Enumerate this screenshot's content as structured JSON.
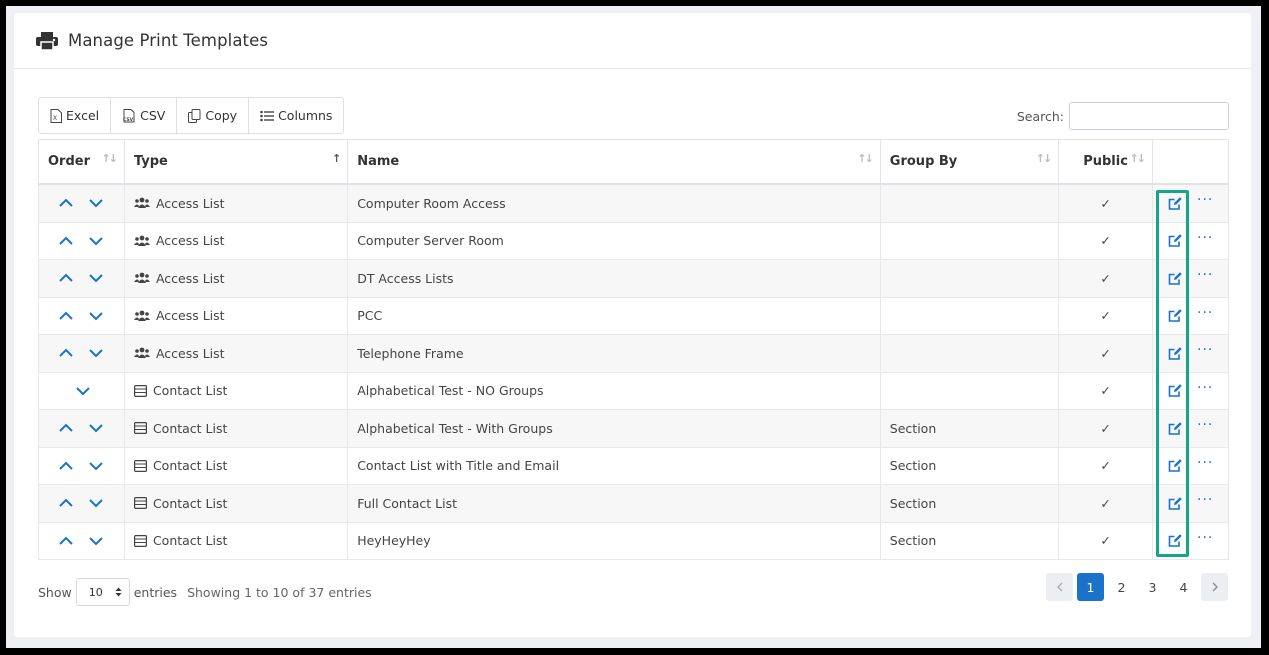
{
  "header": {
    "title": "Manage Print Templates",
    "icon": "printer-icon"
  },
  "toolbar": {
    "buttons": [
      {
        "label": "Excel",
        "icon": "excel-file-icon"
      },
      {
        "label": "CSV",
        "icon": "csv-file-icon"
      },
      {
        "label": "Copy",
        "icon": "copy-icon"
      },
      {
        "label": "Columns",
        "icon": "list-icon"
      }
    ]
  },
  "search": {
    "label": "Search:",
    "value": ""
  },
  "table": {
    "columns": [
      "Order",
      "Type",
      "Name",
      "Group By",
      "Public",
      ""
    ],
    "rows": [
      {
        "type": "Access List",
        "type_icon": "users-icon",
        "name": "Computer Room Access",
        "group_by": "",
        "public": "✓"
      },
      {
        "type": "Access List",
        "type_icon": "users-icon",
        "name": "Computer Server Room",
        "group_by": "",
        "public": "✓"
      },
      {
        "type": "Access List",
        "type_icon": "users-icon",
        "name": "DT Access Lists",
        "group_by": "",
        "public": "✓"
      },
      {
        "type": "Access List",
        "type_icon": "users-icon",
        "name": "PCC",
        "group_by": "",
        "public": "✓"
      },
      {
        "type": "Access List",
        "type_icon": "users-icon",
        "name": "Telephone Frame",
        "group_by": "",
        "public": "✓"
      },
      {
        "type": "Contact List",
        "type_icon": "table-icon",
        "name": "Alphabetical Test - NO Groups",
        "group_by": "",
        "public": "✓"
      },
      {
        "type": "Contact List",
        "type_icon": "table-icon",
        "name": "Alphabetical Test - With Groups",
        "group_by": "Section",
        "public": "✓"
      },
      {
        "type": "Contact List",
        "type_icon": "table-icon",
        "name": "Contact List with Title and Email",
        "group_by": "Section",
        "public": "✓"
      },
      {
        "type": "Contact List",
        "type_icon": "table-icon",
        "name": "Full Contact List",
        "group_by": "Section",
        "public": "✓"
      },
      {
        "type": "Contact List",
        "type_icon": "table-icon",
        "name": "HeyHeyHey",
        "group_by": "Section",
        "public": "✓"
      }
    ]
  },
  "footer": {
    "show_label": "Show",
    "page_size": "10",
    "entries_label": "entries",
    "info": "Showing 1 to 10 of 37 entries",
    "pages": [
      "1",
      "2",
      "3",
      "4"
    ],
    "current_page": "1"
  },
  "colors": {
    "accent": "#1a73c8",
    "highlight": "#17a589"
  }
}
